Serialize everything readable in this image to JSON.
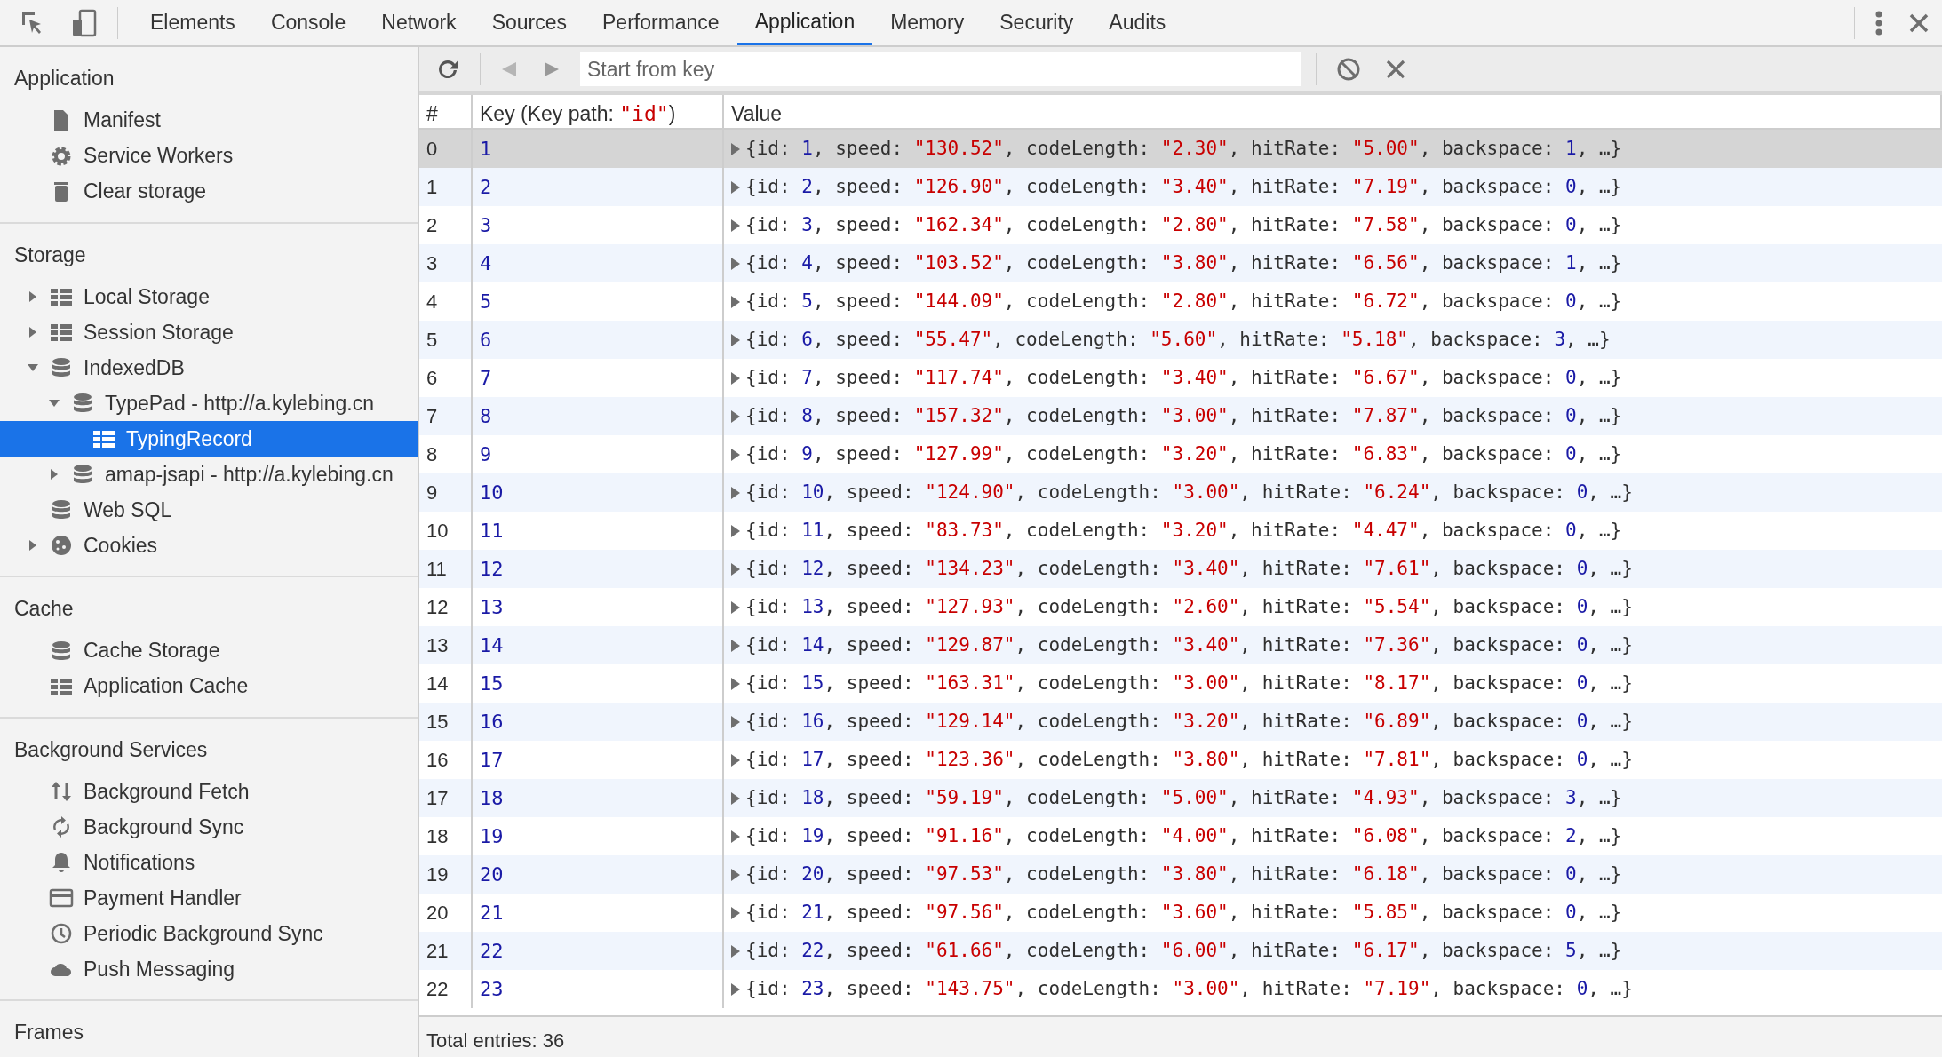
{
  "tabs": [
    {
      "label": "Elements",
      "selected": false
    },
    {
      "label": "Console",
      "selected": false
    },
    {
      "label": "Network",
      "selected": false
    },
    {
      "label": "Sources",
      "selected": false
    },
    {
      "label": "Performance",
      "selected": false
    },
    {
      "label": "Application",
      "selected": true
    },
    {
      "label": "Memory",
      "selected": false
    },
    {
      "label": "Security",
      "selected": false
    },
    {
      "label": "Audits",
      "selected": false
    }
  ],
  "sidebar": {
    "sections": [
      {
        "title": "Application",
        "items": [
          {
            "label": "Manifest",
            "kind": "file",
            "selected": false
          },
          {
            "label": "Service Workers",
            "kind": "gear",
            "selected": false
          },
          {
            "label": "Clear storage",
            "kind": "trash",
            "selected": false
          }
        ]
      },
      {
        "title": "Storage",
        "items": [
          {
            "label": "Local Storage",
            "kind": "grid",
            "selected": false,
            "expanded": false
          },
          {
            "label": "Session Storage",
            "kind": "grid",
            "selected": false,
            "expanded": false
          },
          {
            "label": "IndexedDB",
            "kind": "database",
            "selected": false,
            "expanded": true,
            "children": [
              {
                "label": "TypePad - http://a.kylebing.cn",
                "kind": "database",
                "selected": false,
                "expanded": true,
                "children": [
                  {
                    "label": "TypingRecord",
                    "kind": "grid",
                    "selected": true
                  }
                ]
              },
              {
                "label": "amap-jsapi - http://a.kylebing.cn",
                "kind": "database",
                "selected": false,
                "expanded": false
              }
            ]
          },
          {
            "label": "Web SQL",
            "kind": "database",
            "selected": false
          },
          {
            "label": "Cookies",
            "kind": "cookie",
            "selected": false,
            "expanded": false
          }
        ]
      },
      {
        "title": "Cache",
        "items": [
          {
            "label": "Cache Storage",
            "kind": "database",
            "selected": false
          },
          {
            "label": "Application Cache",
            "kind": "grid",
            "selected": false
          }
        ]
      },
      {
        "title": "Background Services",
        "items": [
          {
            "label": "Background Fetch",
            "kind": "updown",
            "selected": false
          },
          {
            "label": "Background Sync",
            "kind": "sync",
            "selected": false
          },
          {
            "label": "Notifications",
            "kind": "bell",
            "selected": false
          },
          {
            "label": "Payment Handler",
            "kind": "card",
            "selected": false
          },
          {
            "label": "Periodic Background Sync",
            "kind": "clock",
            "selected": false
          },
          {
            "label": "Push Messaging",
            "kind": "cloud",
            "selected": false
          }
        ]
      },
      {
        "title": "Frames"
      }
    ]
  },
  "toolbar": {
    "search": {
      "placeholder": "Start from key"
    }
  },
  "table": {
    "columns": [
      "#",
      "Key (Key path: \"id\")",
      "Value"
    ],
    "rows": [
      {
        "index": "0",
        "key": "1",
        "value": "{id: 1, speed: \"130.52\", codeLength: \"2.30\", hitRate: \"5.00\", backspace: 1, …}",
        "selected": true
      },
      {
        "index": "1",
        "key": "2",
        "value": "{id: 2, speed: \"126.90\", codeLength: \"3.40\", hitRate: \"7.19\", backspace: 0, …}",
        "selected": false
      },
      {
        "index": "2",
        "key": "3",
        "value": "{id: 3, speed: \"162.34\", codeLength: \"2.80\", hitRate: \"7.58\", backspace: 0, …}",
        "selected": false
      },
      {
        "index": "3",
        "key": "4",
        "value": "{id: 4, speed: \"103.52\", codeLength: \"3.80\", hitRate: \"6.56\", backspace: 1, …}",
        "selected": false
      },
      {
        "index": "4",
        "key": "5",
        "value": "{id: 5, speed: \"144.09\", codeLength: \"2.80\", hitRate: \"6.72\", backspace: 0, …}",
        "selected": false
      },
      {
        "index": "5",
        "key": "6",
        "value": "{id: 6, speed: \"55.47\", codeLength: \"5.60\", hitRate: \"5.18\", backspace: 3, …}",
        "selected": false
      },
      {
        "index": "6",
        "key": "7",
        "value": "{id: 7, speed: \"117.74\", codeLength: \"3.40\", hitRate: \"6.67\", backspace: 0, …}",
        "selected": false
      },
      {
        "index": "7",
        "key": "8",
        "value": "{id: 8, speed: \"157.32\", codeLength: \"3.00\", hitRate: \"7.87\", backspace: 0, …}",
        "selected": false
      },
      {
        "index": "8",
        "key": "9",
        "value": "{id: 9, speed: \"127.99\", codeLength: \"3.20\", hitRate: \"6.83\", backspace: 0, …}",
        "selected": false
      },
      {
        "index": "9",
        "key": "10",
        "value": "{id: 10, speed: \"124.90\", codeLength: \"3.00\", hitRate: \"6.24\", backspace: 0, …}",
        "selected": false
      },
      {
        "index": "10",
        "key": "11",
        "value": "{id: 11, speed: \"83.73\", codeLength: \"3.20\", hitRate: \"4.47\", backspace: 0, …}",
        "selected": false
      },
      {
        "index": "11",
        "key": "12",
        "value": "{id: 12, speed: \"134.23\", codeLength: \"3.40\", hitRate: \"7.61\", backspace: 0, …}",
        "selected": false
      },
      {
        "index": "12",
        "key": "13",
        "value": "{id: 13, speed: \"127.93\", codeLength: \"2.60\", hitRate: \"5.54\", backspace: 0, …}",
        "selected": false
      },
      {
        "index": "13",
        "key": "14",
        "value": "{id: 14, speed: \"129.87\", codeLength: \"3.40\", hitRate: \"7.36\", backspace: 0, …}",
        "selected": false
      },
      {
        "index": "14",
        "key": "15",
        "value": "{id: 15, speed: \"163.31\", codeLength: \"3.00\", hitRate: \"8.17\", backspace: 0, …}",
        "selected": false
      },
      {
        "index": "15",
        "key": "16",
        "value": "{id: 16, speed: \"129.14\", codeLength: \"3.20\", hitRate: \"6.89\", backspace: 0, …}",
        "selected": false
      },
      {
        "index": "16",
        "key": "17",
        "value": "{id: 17, speed: \"123.36\", codeLength: \"3.80\", hitRate: \"7.81\", backspace: 0, …}",
        "selected": false
      },
      {
        "index": "17",
        "key": "18",
        "value": "{id: 18, speed: \"59.19\", codeLength: \"5.00\", hitRate: \"4.93\", backspace: 3, …}",
        "selected": false
      },
      {
        "index": "18",
        "key": "19",
        "value": "{id: 19, speed: \"91.16\", codeLength: \"4.00\", hitRate: \"6.08\", backspace: 2, …}",
        "selected": false
      },
      {
        "index": "19",
        "key": "20",
        "value": "{id: 20, speed: \"97.53\", codeLength: \"3.80\", hitRate: \"6.18\", backspace: 0, …}",
        "selected": false
      },
      {
        "index": "20",
        "key": "21",
        "value": "{id: 21, speed: \"97.56\", codeLength: \"3.60\", hitRate: \"5.85\", backspace: 0, …}",
        "selected": false
      },
      {
        "index": "21",
        "key": "22",
        "value": "{id: 22, speed: \"61.66\", codeLength: \"6.00\", hitRate: \"6.17\", backspace: 5, …}",
        "selected": false
      },
      {
        "index": "22",
        "key": "23",
        "value": "{id: 23, speed: \"143.75\", codeLength: \"3.00\", hitRate: \"7.19\", backspace: 0, …}",
        "selected": false
      }
    ]
  },
  "status_bar": {
    "text": "Total entries: 36"
  }
}
